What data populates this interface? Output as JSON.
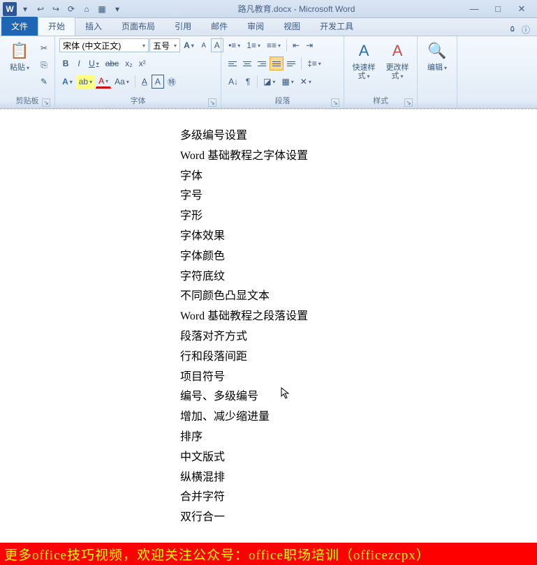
{
  "window": {
    "title": "路凡教育.docx - Microsoft Word",
    "min": "—",
    "max": "□",
    "close": "✕"
  },
  "qat": [
    "W",
    "▾",
    "↩",
    "↪",
    "⟳",
    "⌂",
    "▦",
    "▾"
  ],
  "tabs": {
    "file": "文件",
    "items": [
      "开始",
      "插入",
      "页面布局",
      "引用",
      "邮件",
      "审阅",
      "视图",
      "开发工具"
    ],
    "active": 0,
    "help": "ㅤ"
  },
  "ribbon": {
    "clipboard": {
      "label": "剪贴板",
      "paste": "粘贴",
      "cut": "✂",
      "copy": "⎘",
      "fmt": "✎"
    },
    "font": {
      "label": "字体",
      "name": "宋体 (中文正文)",
      "size": "五号",
      "grow": "A",
      "shrink": "A",
      "case": "Aa",
      "bold": "B",
      "italic": "I",
      "under": "U",
      "strike": "abc",
      "sub": "x₂",
      "sup": "x²",
      "clear": "A",
      "hi": "ab",
      "color": "A",
      "phon": "A",
      "border": "A",
      "circle": "㊕"
    },
    "para": {
      "label": "段落",
      "bullets": "≣",
      "numbers": "≣",
      "multi": "≣",
      "dedent": "◀",
      "indent": "▶",
      "sort": "A↓",
      "marks": "¶",
      "shade": "◪",
      "border": "▦",
      "linespc": "≡"
    },
    "styles": {
      "label": "样式",
      "quick": "快速样式",
      "change": "更改样式"
    },
    "editing": {
      "label": "ㅤ",
      "edit": "编辑"
    }
  },
  "document": [
    "多级编号设置",
    "Word 基础教程之字体设置",
    "字体",
    "字号",
    "字形",
    "字体效果",
    "字体颜色",
    "字符底纹",
    "不同颜色凸显文本",
    "Word 基础教程之段落设置",
    "段落对齐方式",
    "行和段落间距",
    "项目符号",
    "编号、多级编号",
    "增加、减少缩进量",
    "排序",
    "中文版式",
    "纵横混排",
    "合并字符",
    "双行合一"
  ],
  "footer": "更多office技巧视频，欢迎关注公众号：office职场培训（officezcpx）"
}
